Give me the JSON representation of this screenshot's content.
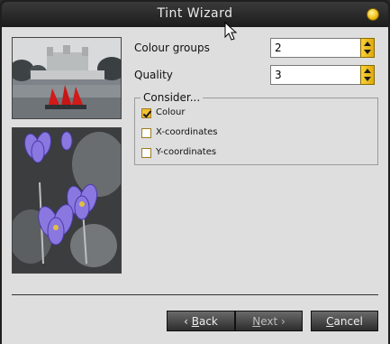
{
  "window": {
    "title": "Tint Wizard",
    "icons": {
      "close": "close-icon",
      "cursor": "mouse-pointer-icon"
    }
  },
  "images": {
    "top": "tower-photo",
    "bottom": "flower-photo"
  },
  "options": {
    "colour_groups": {
      "label": "Colour groups",
      "value": "2"
    },
    "quality": {
      "label": "Quality",
      "value": "3"
    }
  },
  "consider": {
    "legend": "Consider...",
    "items": [
      {
        "label": "Colour",
        "checked": true
      },
      {
        "label": "X-coordinates",
        "checked": false
      },
      {
        "label": "Y-coordinates",
        "checked": false
      }
    ]
  },
  "buttons": {
    "back": {
      "arrow": "‹ ",
      "accel": "B",
      "rest": "ack"
    },
    "next": {
      "accel": "N",
      "rest": "ext",
      "arrow": " ›"
    },
    "cancel": {
      "accel": "C",
      "rest": "ancel"
    }
  },
  "colors": {
    "accent": "#f0c030",
    "window_bg": "#dedede",
    "titlebar": "#1c1c1c"
  }
}
